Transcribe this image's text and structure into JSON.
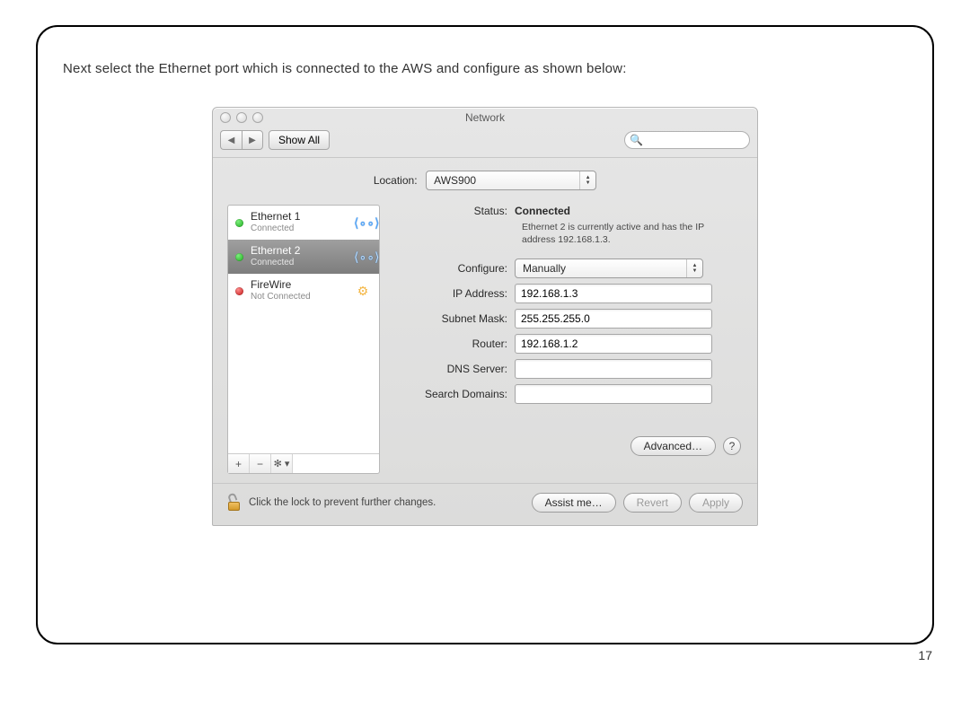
{
  "page": {
    "instructions": "Next select the Ethernet port which is connected to the AWS and configure as shown below:",
    "page_number": "17"
  },
  "window": {
    "title": "Network",
    "show_all": "Show All",
    "search_placeholder": "",
    "location_label": "Location:",
    "location_value": "AWS900",
    "sidebar": {
      "items": [
        {
          "name": "Ethernet 1",
          "sub": "Connected",
          "status": "green",
          "icon": "eth",
          "selected": false
        },
        {
          "name": "Ethernet 2",
          "sub": "Connected",
          "status": "green",
          "icon": "eth",
          "selected": true
        },
        {
          "name": "FireWire",
          "sub": "Not Connected",
          "status": "red",
          "icon": "fw",
          "selected": false
        }
      ],
      "add": "+",
      "remove": "−",
      "gear": "✻ ▾"
    },
    "details": {
      "status_label": "Status:",
      "status_value": "Connected",
      "status_desc": "Ethernet 2 is currently active and has the IP address 192.168.1.3.",
      "configure_label": "Configure:",
      "configure_value": "Manually",
      "ip_label": "IP Address:",
      "ip_value": "192.168.1.3",
      "subnet_label": "Subnet Mask:",
      "subnet_value": "255.255.255.0",
      "router_label": "Router:",
      "router_value": "192.168.1.2",
      "dns_label": "DNS Server:",
      "dns_value": "",
      "search_label": "Search Domains:",
      "search_value": "",
      "advanced": "Advanced…",
      "help": "?"
    },
    "footer": {
      "lock_text": "Click the lock to prevent further changes.",
      "assist": "Assist me…",
      "revert": "Revert",
      "apply": "Apply"
    }
  }
}
